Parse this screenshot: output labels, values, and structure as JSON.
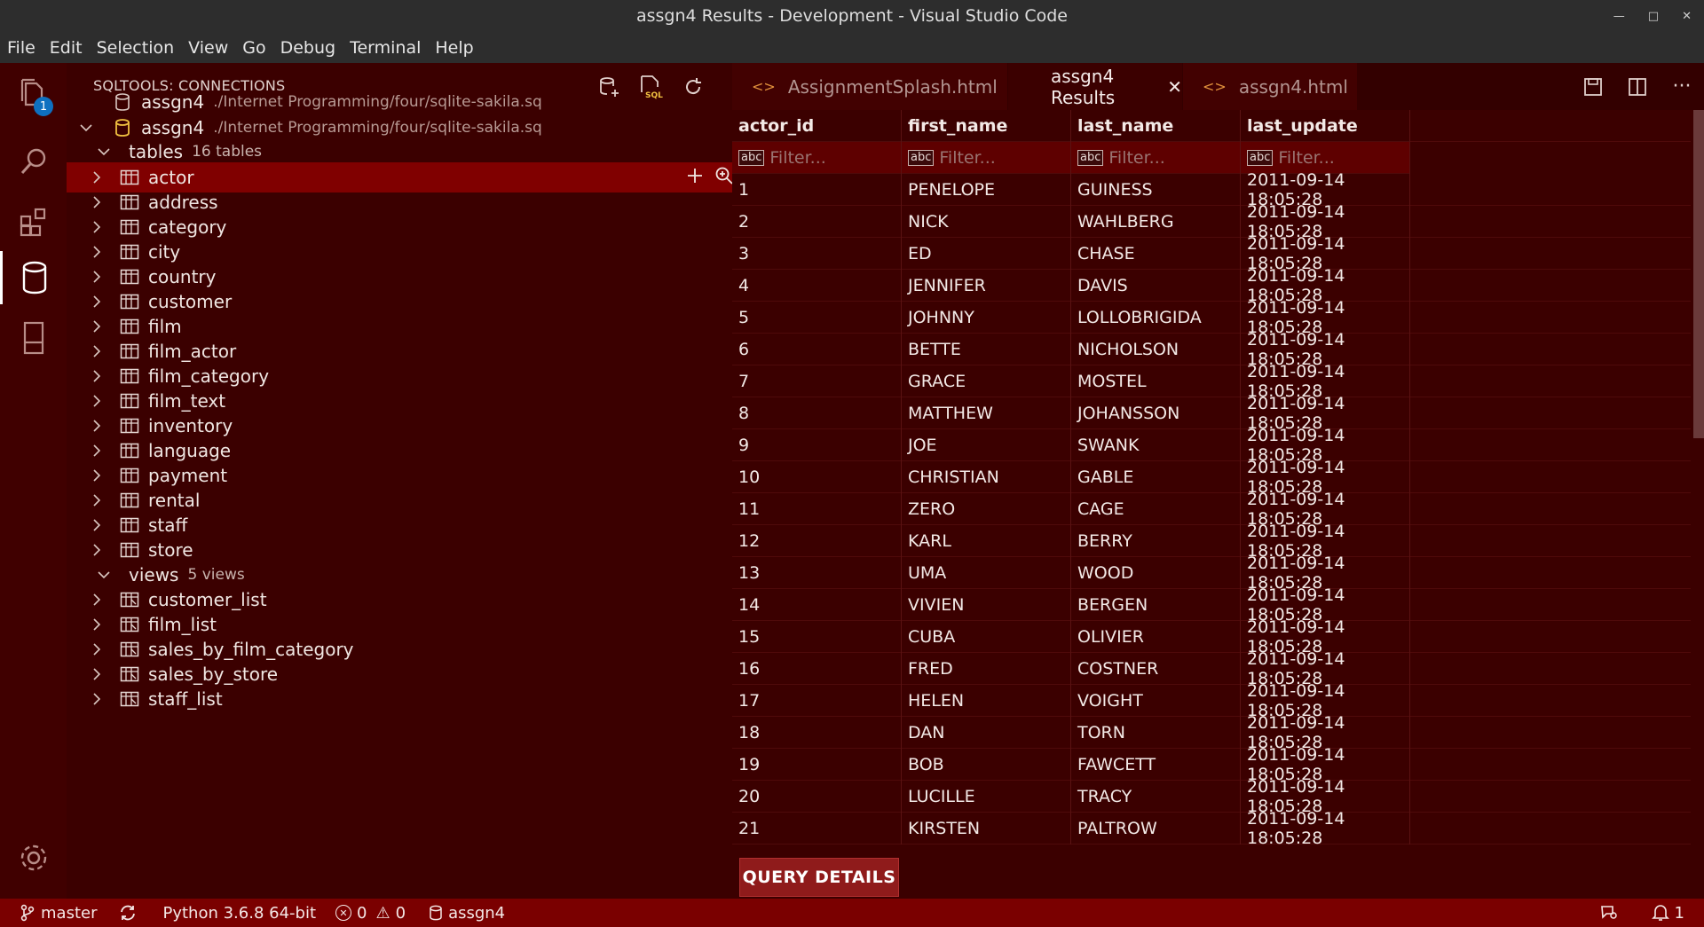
{
  "window": {
    "title": "assgn4 Results - Development - Visual Studio Code"
  },
  "menu": [
    "File",
    "Edit",
    "Selection",
    "View",
    "Go",
    "Debug",
    "Terminal",
    "Help"
  ],
  "activity": {
    "explorer_badge": "1"
  },
  "sidebar": {
    "header": "SQLTOOLS: CONNECTIONS",
    "connections": [
      {
        "name": "assgn4",
        "path": "./Internet Programming/four/sqlite-sakila.sq",
        "expanded": false
      },
      {
        "name": "assgn4",
        "path": "./Internet Programming/four/sqlite-sakila.sq",
        "expanded": true
      }
    ],
    "tables_group": {
      "label": "tables",
      "count": "16 tables"
    },
    "tables": [
      "actor",
      "address",
      "category",
      "city",
      "country",
      "customer",
      "film",
      "film_actor",
      "film_category",
      "film_text",
      "inventory",
      "language",
      "payment",
      "rental",
      "staff",
      "store"
    ],
    "views_group": {
      "label": "views",
      "count": "5 views"
    },
    "views": [
      "customer_list",
      "film_list",
      "sales_by_film_category",
      "sales_by_store",
      "staff_list"
    ]
  },
  "editor": {
    "tabs": [
      {
        "label": "AssignmentSplash.html"
      },
      {
        "label": "assgn4 Results"
      },
      {
        "label": "assgn4.html"
      }
    ],
    "columns": [
      "actor_id",
      "first_name",
      "last_name",
      "last_update"
    ],
    "filter_placeholder": "Filter...",
    "filter_icon": "abc",
    "rows": [
      [
        "1",
        "PENELOPE",
        "GUINESS",
        "2011-09-14 18:05:28"
      ],
      [
        "2",
        "NICK",
        "WAHLBERG",
        "2011-09-14 18:05:28"
      ],
      [
        "3",
        "ED",
        "CHASE",
        "2011-09-14 18:05:28"
      ],
      [
        "4",
        "JENNIFER",
        "DAVIS",
        "2011-09-14 18:05:28"
      ],
      [
        "5",
        "JOHNNY",
        "LOLLOBRIGIDA",
        "2011-09-14 18:05:28"
      ],
      [
        "6",
        "BETTE",
        "NICHOLSON",
        "2011-09-14 18:05:28"
      ],
      [
        "7",
        "GRACE",
        "MOSTEL",
        "2011-09-14 18:05:28"
      ],
      [
        "8",
        "MATTHEW",
        "JOHANSSON",
        "2011-09-14 18:05:28"
      ],
      [
        "9",
        "JOE",
        "SWANK",
        "2011-09-14 18:05:28"
      ],
      [
        "10",
        "CHRISTIAN",
        "GABLE",
        "2011-09-14 18:05:28"
      ],
      [
        "11",
        "ZERO",
        "CAGE",
        "2011-09-14 18:05:28"
      ],
      [
        "12",
        "KARL",
        "BERRY",
        "2011-09-14 18:05:28"
      ],
      [
        "13",
        "UMA",
        "WOOD",
        "2011-09-14 18:05:28"
      ],
      [
        "14",
        "VIVIEN",
        "BERGEN",
        "2011-09-14 18:05:28"
      ],
      [
        "15",
        "CUBA",
        "OLIVIER",
        "2011-09-14 18:05:28"
      ],
      [
        "16",
        "FRED",
        "COSTNER",
        "2011-09-14 18:05:28"
      ],
      [
        "17",
        "HELEN",
        "VOIGHT",
        "2011-09-14 18:05:28"
      ],
      [
        "18",
        "DAN",
        "TORN",
        "2011-09-14 18:05:28"
      ],
      [
        "19",
        "BOB",
        "FAWCETT",
        "2011-09-14 18:05:28"
      ],
      [
        "20",
        "LUCILLE",
        "TRACY",
        "2011-09-14 18:05:28"
      ],
      [
        "21",
        "KIRSTEN",
        "PALTROW",
        "2011-09-14 18:05:28"
      ]
    ],
    "query_details_label": "QUERY DETAILS"
  },
  "statusbar": {
    "branch": "master",
    "python": "Python 3.6.8 64-bit",
    "errors": "0",
    "warnings": "0",
    "connection": "assgn4",
    "notifications": "1"
  },
  "colors": {
    "accent": "#800000",
    "statusbar": "#7a0000",
    "badge": "#0e70c0",
    "tab_icon": "#e0903c"
  }
}
